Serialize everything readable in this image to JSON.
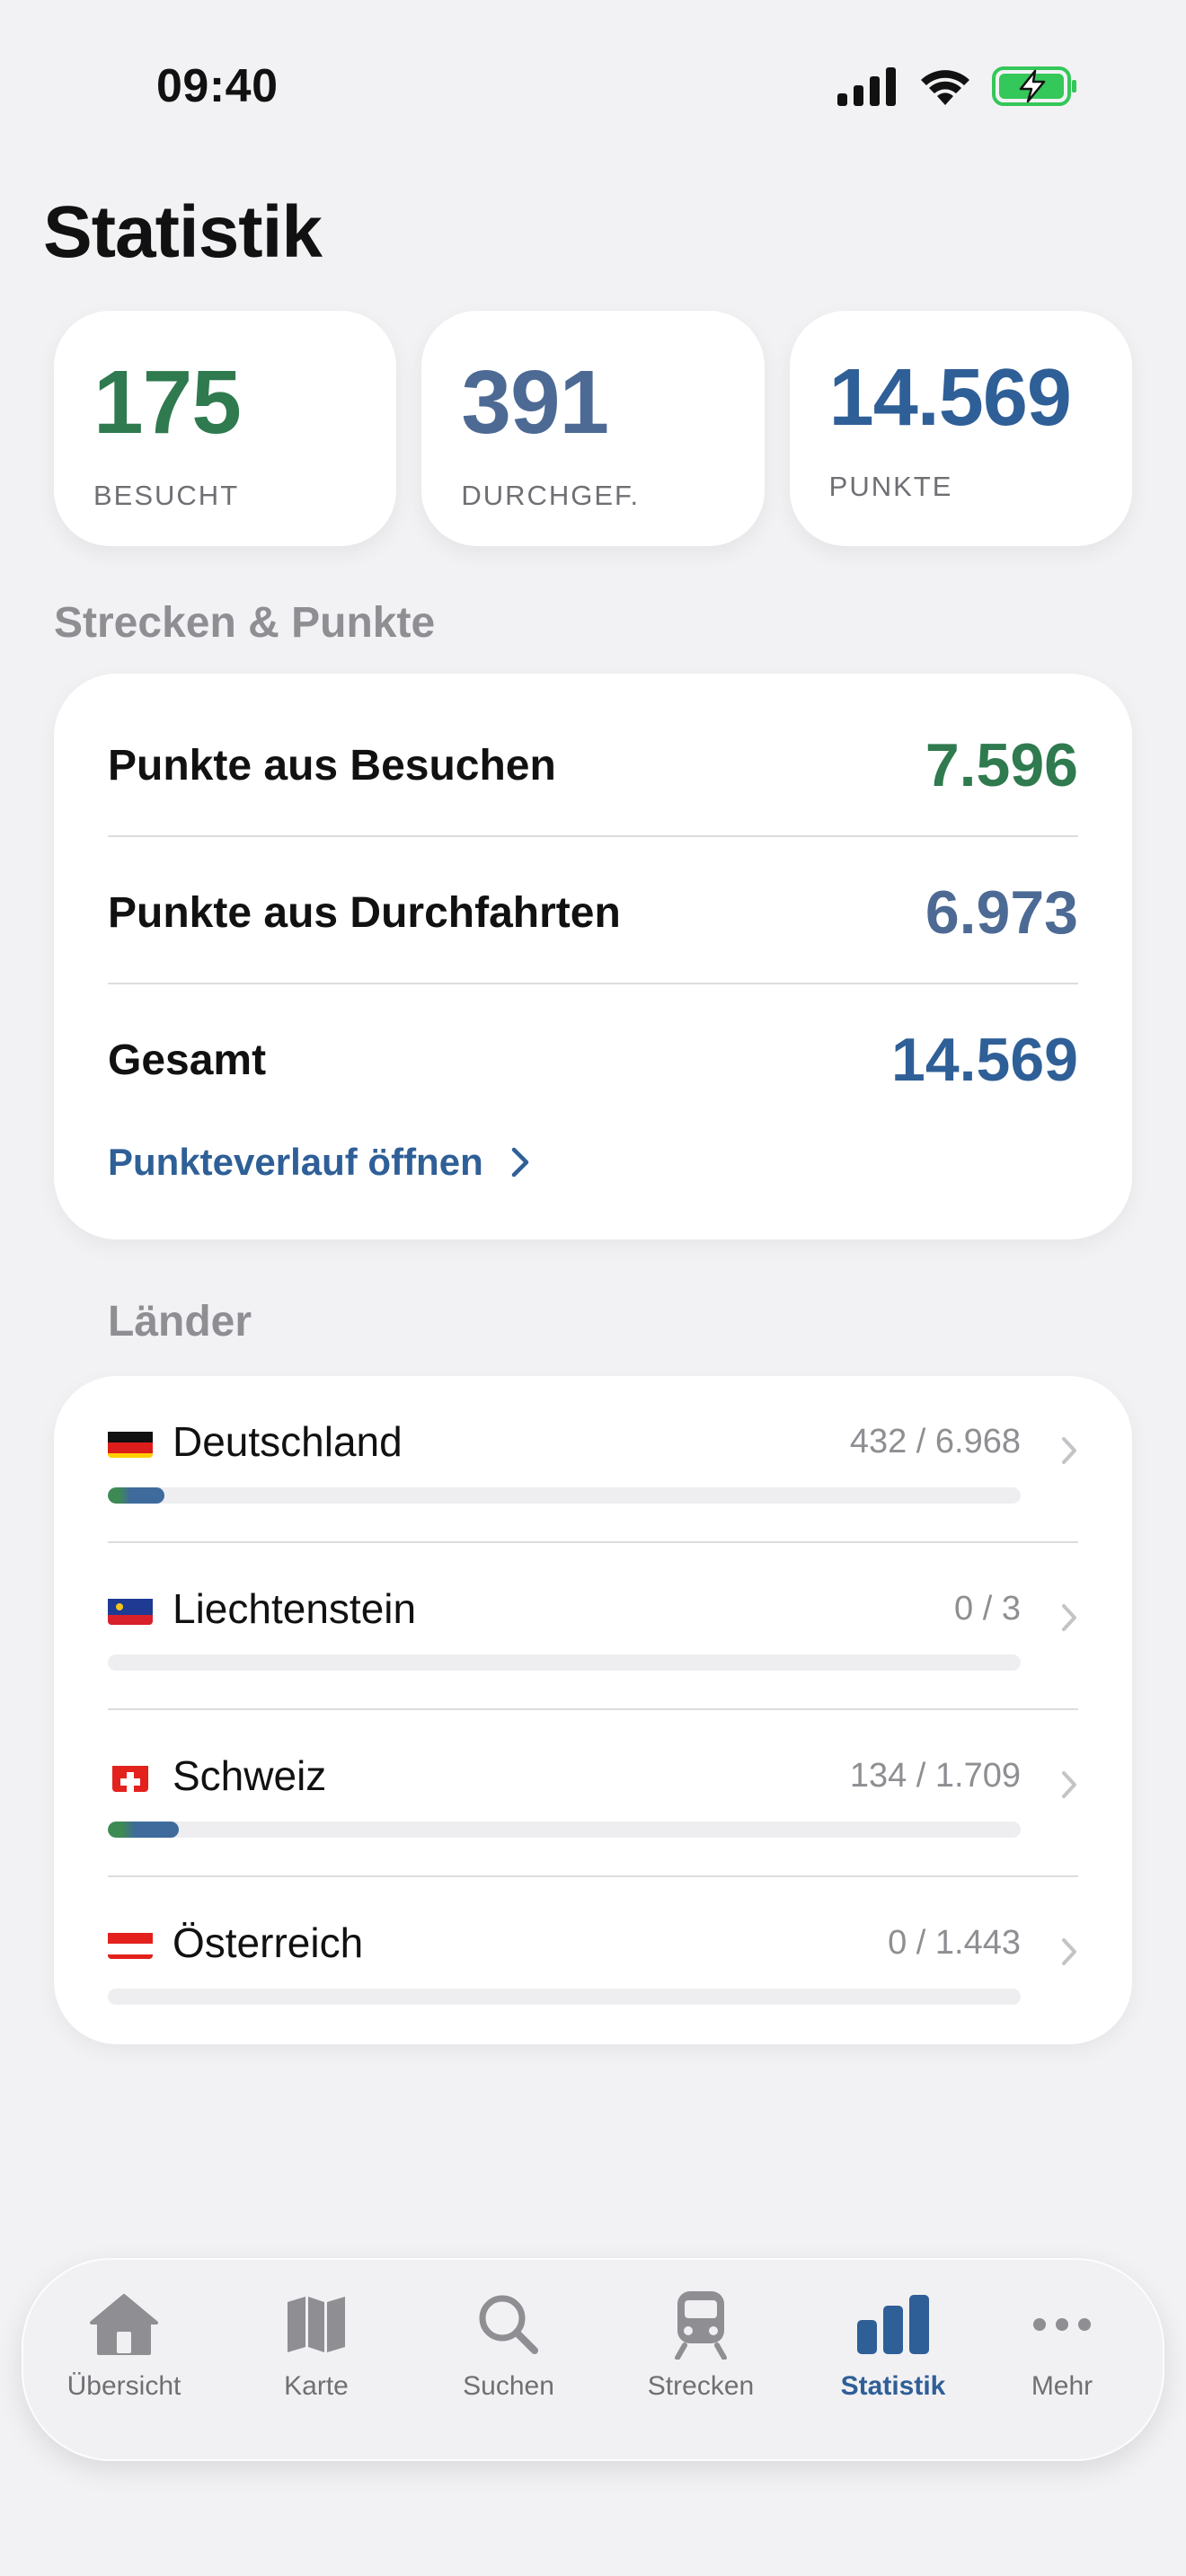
{
  "status": {
    "time": "09:40"
  },
  "title": "Statistik",
  "summary": [
    {
      "value": "175",
      "label": "BESUCHT",
      "color": "#2f7a4e"
    },
    {
      "value": "391",
      "label": "DURCHGEF.",
      "color": "#4c6a94"
    },
    {
      "value": "14.569",
      "label": "PUNKTE",
      "color": "#2f5f97"
    }
  ],
  "points_section": {
    "title": "Strecken & Punkte",
    "rows": [
      {
        "label": "Punkte aus Besuchen",
        "value": "7.596",
        "color": "#2f7a4e"
      },
      {
        "label": "Punkte aus Durchfahrten",
        "value": "6.973",
        "color": "#4c6a94"
      },
      {
        "label": "Gesamt",
        "value": "14.569",
        "color": "#2f5f97"
      }
    ],
    "link": "Punkteverlauf öffnen"
  },
  "countries_section": {
    "title": "Länder",
    "items": [
      {
        "name": "Deutschland",
        "count": "432 / 6.968",
        "progress": 0.062,
        "flag": "de"
      },
      {
        "name": "Liechtenstein",
        "count": "0 / 3",
        "progress": 0,
        "flag": "li"
      },
      {
        "name": "Schweiz",
        "count": "134 / 1.709",
        "progress": 0.078,
        "flag": "ch"
      },
      {
        "name": "Österreich",
        "count": "0 / 1.443",
        "progress": 0,
        "flag": "at"
      }
    ]
  },
  "tabbar": {
    "tabs": [
      {
        "label": "Übersicht",
        "icon": "house-icon",
        "active": false
      },
      {
        "label": "Karte",
        "icon": "map-icon",
        "active": false
      },
      {
        "label": "Suchen",
        "icon": "search-icon",
        "active": false
      },
      {
        "label": "Strecken",
        "icon": "train-icon",
        "active": false
      },
      {
        "label": "Statistik",
        "icon": "chart-bars-icon",
        "active": true
      },
      {
        "label": "Mehr",
        "icon": "more-icon",
        "active": false
      }
    ],
    "active_color": "#2f5f97",
    "inactive_color": "#8e8e93"
  }
}
